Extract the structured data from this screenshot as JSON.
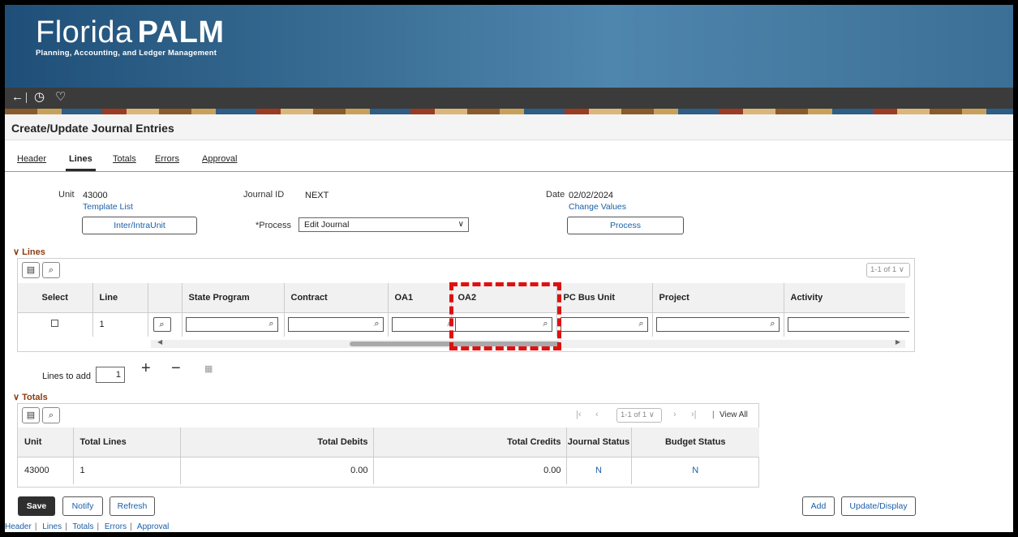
{
  "app": {
    "logo_main_thin": "Florida",
    "logo_main_bold": "PALM",
    "logo_sub": "Planning, Accounting, and Ledger Management"
  },
  "navbar": {
    "back_icon": "←",
    "history_icon": "◷",
    "favorites_icon": "♡"
  },
  "page": {
    "title": "Create/Update Journal Entries"
  },
  "tabs": [
    "Header",
    "Lines",
    "Totals",
    "Errors",
    "Approval"
  ],
  "header": {
    "unit_label": "Unit",
    "unit_value": "43000",
    "template_list": "Template List",
    "inter_btn": "Inter/IntraUnit",
    "journal_id_label": "Journal ID",
    "journal_id_value": "NEXT",
    "process_label": "*Process",
    "process_value": "Edit Journal",
    "date_label": "Date",
    "date_value": "02/02/2024",
    "change_values": "Change Values",
    "process_btn": "Process"
  },
  "lines": {
    "section_label": "Lines",
    "pager": "1-1 of 1",
    "columns": [
      "Select",
      "Line",
      "",
      "State Program",
      "Contract",
      "OA1",
      "OA2",
      "PC Bus Unit",
      "Project",
      "Activity"
    ],
    "row": {
      "line": "1"
    },
    "lines_to_add_label": "Lines to add",
    "lines_to_add_value": "1"
  },
  "totals": {
    "section_label": "Totals",
    "pager": "1-1 of 1",
    "view_all": "View All",
    "columns": [
      "Unit",
      "Total Lines",
      "Total Debits",
      "Total Credits",
      "Journal Status",
      "Budget Status"
    ],
    "row": {
      "unit": "43000",
      "total_lines": "1",
      "total_debits": "0.00",
      "total_credits": "0.00",
      "journal_status": "N",
      "budget_status": "N"
    }
  },
  "actions": {
    "save": "Save",
    "notify": "Notify",
    "refresh": "Refresh",
    "add": "Add",
    "update_display": "Update/Display"
  },
  "footer_links": [
    "Header",
    "Lines",
    "Totals",
    "Errors",
    "Approval"
  ]
}
